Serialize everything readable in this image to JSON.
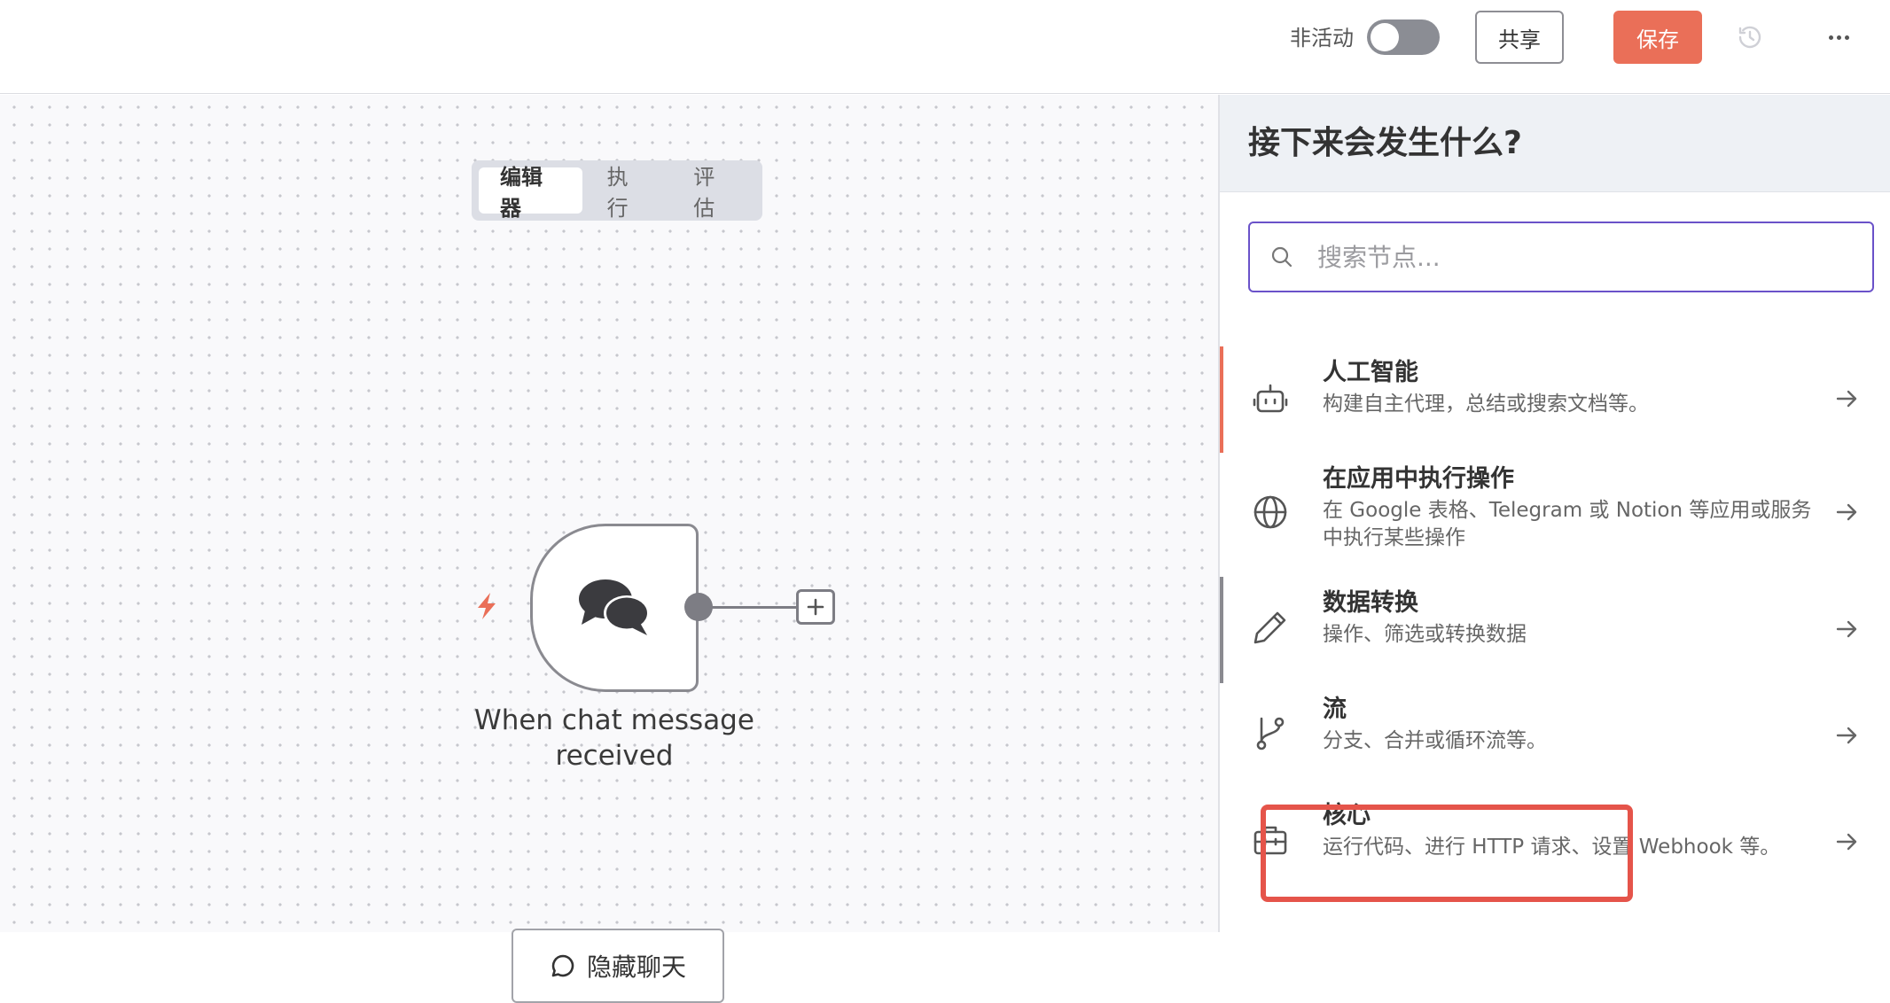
{
  "topbar": {
    "status_label": "非活动",
    "share_label": "共享",
    "save_label": "保存",
    "accent_color": "#ea6f58"
  },
  "canvas": {
    "tabs": [
      {
        "label": "编辑器",
        "active": true
      },
      {
        "label": "执行",
        "active": false
      },
      {
        "label": "评估",
        "active": false
      }
    ],
    "node": {
      "label_line1": "When chat message",
      "label_line2": "received",
      "icon": "chat-bubbles-icon"
    },
    "hide_chat_label": "隐藏聊天"
  },
  "panel": {
    "title": "接下来会发生什么?",
    "search_placeholder": "搜索节点...",
    "categories": [
      {
        "icon": "robot-icon",
        "title": "人工智能",
        "desc": "构建自主代理，总结或搜索文档等。"
      },
      {
        "icon": "globe-icon",
        "title": "在应用中执行操作",
        "desc": "在 Google 表格、Telegram 或 Notion 等应用或服务中执行某些操作"
      },
      {
        "icon": "pencil-icon",
        "title": "数据转换",
        "desc": "操作、筛选或转换数据"
      },
      {
        "icon": "branch-icon",
        "title": "流",
        "desc": "分支、合并或循环流等。"
      },
      {
        "icon": "toolbox-icon",
        "title": "核心",
        "desc": "运行代码、进行 HTTP 请求、设置 Webhook 等。"
      }
    ]
  }
}
